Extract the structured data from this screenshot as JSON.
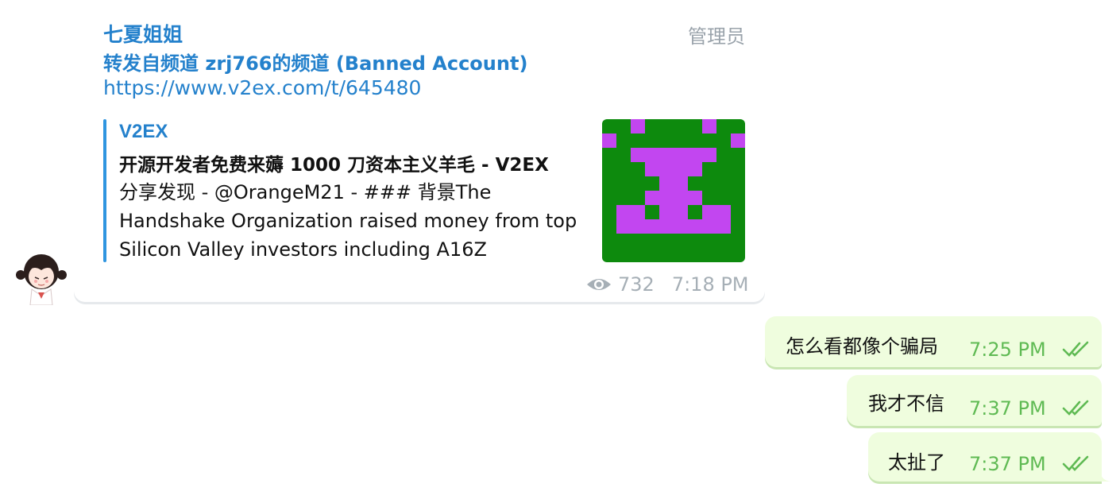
{
  "channel_post": {
    "sender": "七夏姐姐",
    "role": "管理员",
    "forwarded_from": "转发自频道 zrj766的频道 (Banned Account)",
    "link": "https://www.v2ex.com/t/645480",
    "preview": {
      "site": "V2EX",
      "title": "开源开发者免费来薅 1000 刀资本主义羊毛 - V2EX",
      "description_lines": [
        "分享发现 - @OrangeM21 - ### 背景The",
        "Handshake Organization raised money from top",
        "Silicon Valley investors including A16Z"
      ]
    },
    "views": "732",
    "time": "7:18 PM"
  },
  "outgoing_messages": [
    {
      "text": "怎么看都像个骗局",
      "time": "7:25 PM",
      "status": "read"
    },
    {
      "text": "我才不信",
      "time": "7:37 PM",
      "status": "read"
    },
    {
      "text": "太扯了",
      "time": "7:37 PM",
      "status": "read"
    }
  ],
  "colors": {
    "link_blue": "#2481cc",
    "outgoing_bg": "#effdde",
    "outgoing_time": "#5fba53",
    "thumb_green": "#0d8a0d",
    "thumb_purple": "#c246f0"
  }
}
